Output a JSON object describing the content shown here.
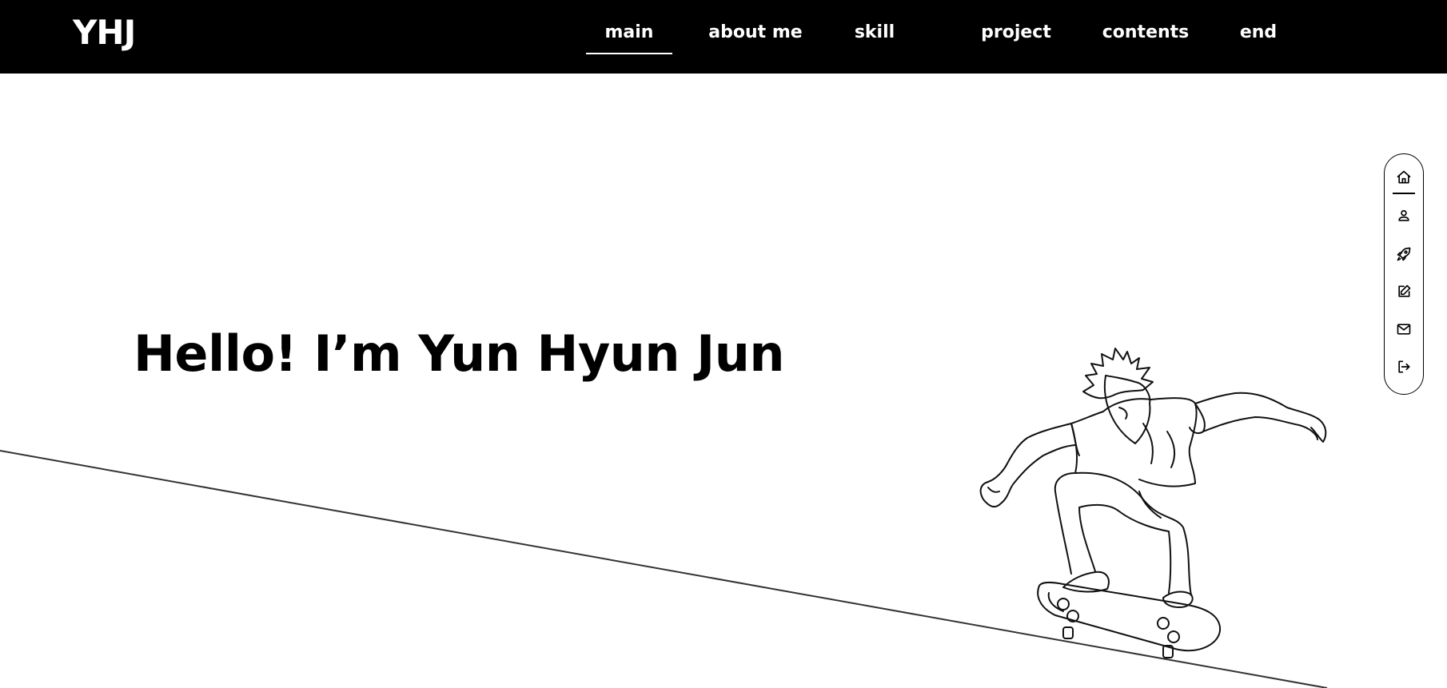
{
  "header": {
    "logo": "YHJ",
    "nav": [
      {
        "label": "main",
        "active": true
      },
      {
        "label": "about me",
        "active": false
      },
      {
        "label": "skill",
        "active": false
      },
      {
        "label": "project",
        "active": false
      },
      {
        "label": "contents",
        "active": false
      },
      {
        "label": "end",
        "active": false
      }
    ]
  },
  "hero": {
    "title": "Hello! I’m Yun Hyun Jun"
  },
  "sidenav": {
    "items": [
      {
        "icon": "home-icon"
      },
      {
        "icon": "user-icon"
      },
      {
        "icon": "rocket-icon"
      },
      {
        "icon": "edit-icon"
      },
      {
        "icon": "mail-icon"
      },
      {
        "icon": "logout-icon"
      }
    ]
  },
  "colors": {
    "header_bg": "#000000",
    "header_text": "#ffffff",
    "page_bg": "#ffffff",
    "ink": "#000000"
  }
}
